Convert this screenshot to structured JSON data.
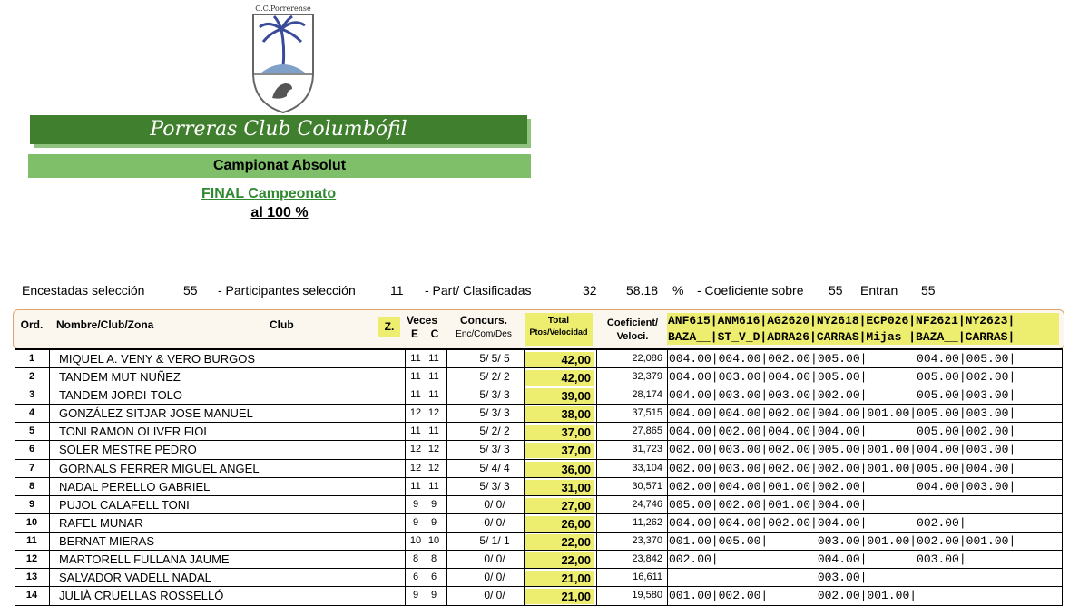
{
  "logo": {
    "caption": "C.C.Porrerense",
    "icon": "palm-pigeon-shield-icon"
  },
  "club_title": "Porreras Club Columbófil",
  "championship": {
    "title_part1": "Campionat Absolut",
    "title_part2": "al 100 %"
  },
  "final_link": "FINAL Campeonato",
  "stats": {
    "encestadas_label": "Encestadas selección",
    "encestadas_value": "55",
    "participantes_label": "- Participantes selección",
    "participantes_value": "11",
    "part_clas_label": "- Part/ Clasificadas",
    "part_clas_value": "32",
    "percent_value": "58.18",
    "percent_sign": "%",
    "coef_label": "- Coeficiente sobre",
    "coef_value": "55",
    "entran_label": "Entran",
    "entran_value": "55"
  },
  "headers": {
    "ord": "Ord.",
    "nombre": "Nombre/Club/Zona",
    "club": "Club",
    "z": "Z.",
    "veces": "Veces",
    "veces_e": "E",
    "veces_c": "C",
    "concurs": "Concurs.",
    "concurs_sub": "Enc/Com/Des",
    "total": "Total",
    "total_sub": "Ptos/Velocidad",
    "coef": "Coeficient/",
    "coef_sub": "Veloci.",
    "codes_line1": "ANF615|ANM616|AG2620|NY2618|ECP026|NF2621|NY2623|",
    "codes_line2": "BAZA__|ST_V_D|ADRA26|CARRAS|Mijas |BAZA__|CARRAS|"
  },
  "rows": [
    {
      "ord": "1",
      "name": "MIQUEL A. VENY & VERO BURGOS",
      "e": "11",
      "c": "11",
      "conc": "5/  5/ 5",
      "pts": "42,00",
      "coef": "22,086",
      "res": "004.00|004.00|002.00|005.00|       004.00|005.00|"
    },
    {
      "ord": "2",
      "name": "TANDEM MUT NUÑEZ",
      "e": "11",
      "c": "11",
      "conc": "5/  2/ 2",
      "pts": "42,00",
      "coef": "32,379",
      "res": "004.00|003.00|004.00|005.00|       005.00|002.00|"
    },
    {
      "ord": "3",
      "name": "TANDEM JORDI-TOLO",
      "e": "11",
      "c": "11",
      "conc": "5/  3/ 3",
      "pts": "39,00",
      "coef": "28,174",
      "res": "004.00|003.00|003.00|002.00|       005.00|003.00|"
    },
    {
      "ord": "4",
      "name": "GONZÁLEZ SITJAR JOSE MANUEL",
      "e": "12",
      "c": "12",
      "conc": "5/  3/ 3",
      "pts": "38,00",
      "coef": "37,515",
      "res": "004.00|004.00|002.00|004.00|001.00|005.00|003.00|"
    },
    {
      "ord": "5",
      "name": "TONI RAMON OLIVER FIOL",
      "e": "11",
      "c": "11",
      "conc": "5/  2/ 2",
      "pts": "37,00",
      "coef": "27,865",
      "res": "004.00|002.00|004.00|004.00|       005.00|002.00|"
    },
    {
      "ord": "6",
      "name": "SOLER MESTRE PEDRO",
      "e": "12",
      "c": "12",
      "conc": "5/  3/ 3",
      "pts": "37,00",
      "coef": "31,723",
      "res": "002.00|003.00|002.00|005.00|001.00|004.00|003.00|"
    },
    {
      "ord": "7",
      "name": "GORNALS FERRER MIGUEL ANGEL",
      "e": "12",
      "c": "12",
      "conc": "5/  4/ 4",
      "pts": "36,00",
      "coef": "33,104",
      "res": "002.00|003.00|002.00|002.00|001.00|005.00|004.00|"
    },
    {
      "ord": "8",
      "name": "NADAL PERELLO GABRIEL",
      "e": "11",
      "c": "11",
      "conc": "5/  3/ 3",
      "pts": "31,00",
      "coef": "30,571",
      "res": "002.00|004.00|001.00|002.00|       004.00|003.00|"
    },
    {
      "ord": "9",
      "name": "PUJOL CALAFELL TONI",
      "e": "9",
      "c": "9",
      "conc": "0/  0/",
      "pts": "27,00",
      "coef": "24,746",
      "res": "005.00|002.00|001.00|004.00|"
    },
    {
      "ord": "10",
      "name": "RAFEL MUNAR",
      "e": "9",
      "c": "9",
      "conc": "0/  0/",
      "pts": "26,00",
      "coef": "11,262",
      "res": "004.00|004.00|002.00|004.00|       002.00|"
    },
    {
      "ord": "11",
      "name": "BERNAT MIERAS",
      "e": "10",
      "c": "10",
      "conc": "5/  1/ 1",
      "pts": "22,00",
      "coef": "23,370",
      "res": "001.00|005.00|       003.00|001.00|002.00|001.00|"
    },
    {
      "ord": "12",
      "name": "MARTORELL FULLANA JAUME",
      "e": "8",
      "c": "8",
      "conc": "0/  0/",
      "pts": "22,00",
      "coef": "23,842",
      "res": "002.00|              004.00|       003.00|"
    },
    {
      "ord": "13",
      "name": "SALVADOR VADELL NADAL",
      "e": "6",
      "c": "6",
      "conc": "0/  0/",
      "pts": "21,00",
      "coef": "16,611",
      "res": "                     003.00|"
    },
    {
      "ord": "14",
      "name": "JULIÀ CRUELLAS ROSSELLÓ",
      "e": "9",
      "c": "9",
      "conc": "0/  0/",
      "pts": "21,00",
      "coef": "19,580",
      "res": "001.00|002.00|       002.00|001.00|"
    }
  ]
}
